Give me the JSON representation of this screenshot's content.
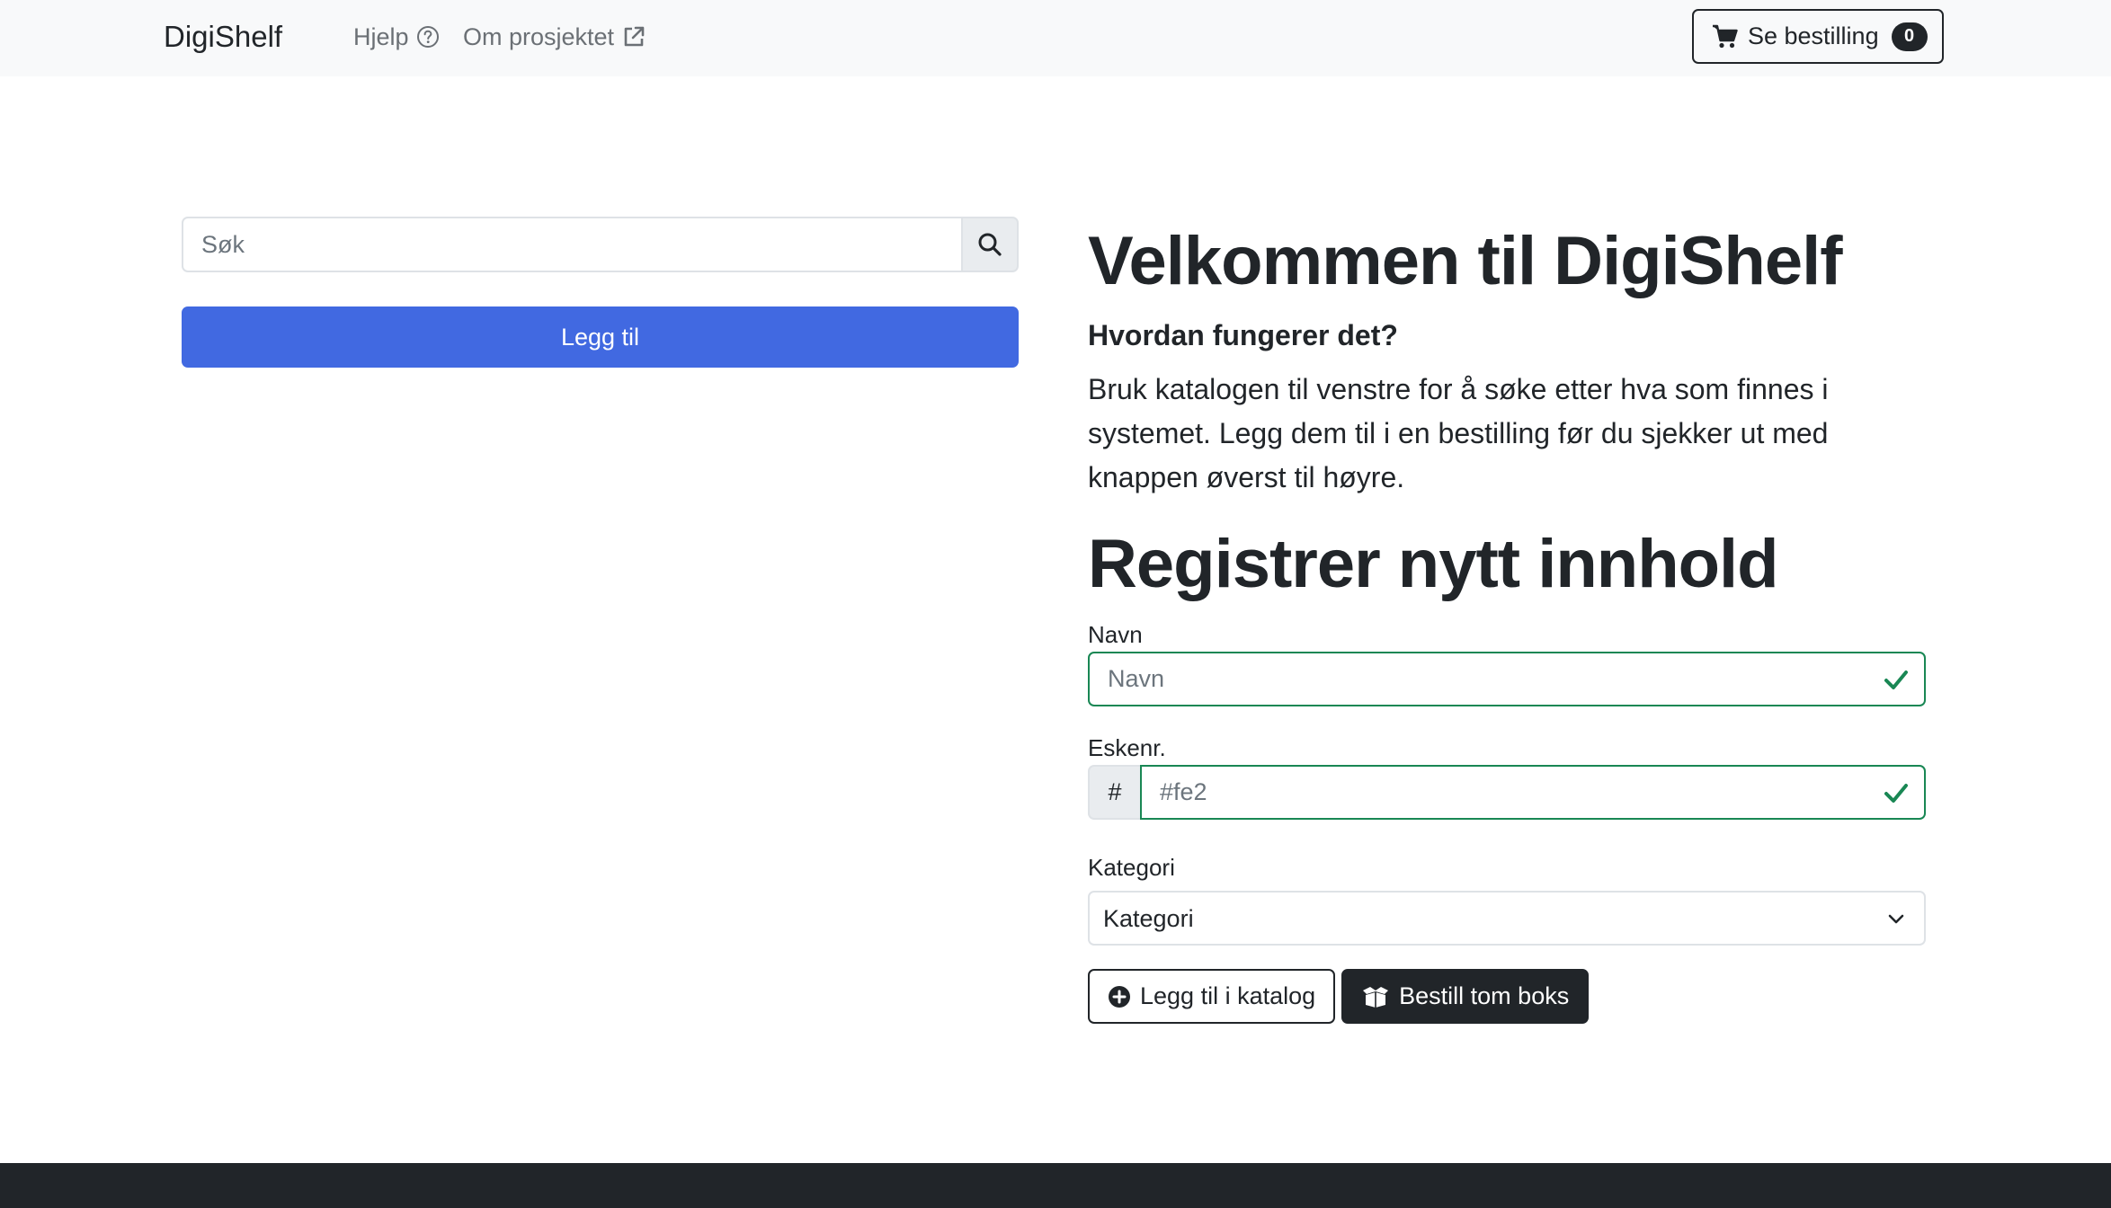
{
  "navbar": {
    "brand": "DigiShelf",
    "help_label": "Hjelp",
    "about_label": "Om prosjektet",
    "order_label": "Se bestilling",
    "order_count": "0"
  },
  "catalog": {
    "search_placeholder": "Søk",
    "add_label": "Legg til"
  },
  "welcome": {
    "title": "Velkommen til DigiShelf",
    "subtitle": "Hvordan fungerer det?",
    "body": "Bruk katalogen til venstre for å søke etter hva som finnes i systemet. Legg dem til i en bestilling før du sjekker ut med knappen øverst til høyre."
  },
  "register": {
    "title": "Registrer nytt innhold",
    "name_label": "Navn",
    "name_placeholder": "Navn",
    "box_label": "Eskenr.",
    "box_prefix": "#",
    "box_placeholder": "#fe2",
    "category_label": "Kategori",
    "category_selected": "Kategori",
    "add_catalog_label": "Legg til i katalog",
    "order_empty_box_label": "Bestill tom boks"
  },
  "colors": {
    "primary": "#4169e1",
    "valid": "#198754",
    "dark": "#212529",
    "navbar_bg": "#f8f9fa"
  },
  "icons": {
    "help": "question-circle-icon",
    "about": "external-link-icon",
    "cart": "cart-icon",
    "search": "search-icon",
    "check": "check-icon",
    "chevron": "chevron-down-icon",
    "plus": "plus-circle-icon",
    "box": "box-open-icon"
  }
}
